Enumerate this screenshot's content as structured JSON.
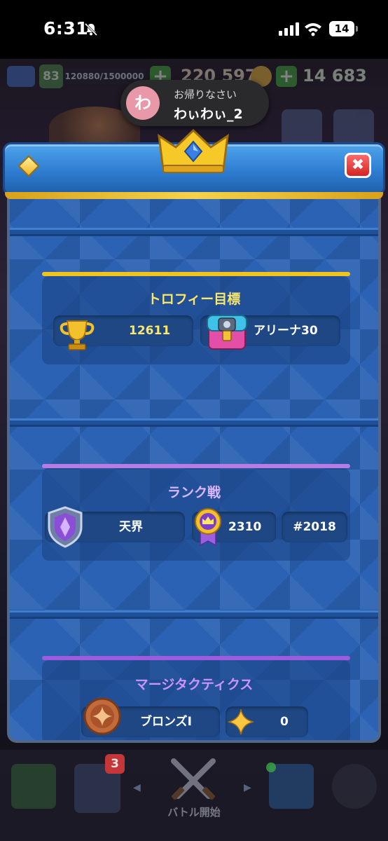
{
  "status_bar": {
    "time": "6:31",
    "battery": "14"
  },
  "hud": {
    "level": "83",
    "xp": "120880/1500000",
    "gold": "220 597",
    "gems": "14 683"
  },
  "toast": {
    "avatar_letter": "わ",
    "title": "お帰りなさい",
    "name": "わぃわぃ_2"
  },
  "modal": {
    "close_label": "✖"
  },
  "trophy_section": {
    "title": "トロフィー目標",
    "trophies": "12611",
    "arena": "アリーナ30"
  },
  "ranked_section": {
    "title": "ランク戦",
    "league": "天界",
    "rating": "2310",
    "rank": "#2018"
  },
  "tactics_section": {
    "title": "マージタクティクス",
    "league": "ブロンズI",
    "points": "0"
  },
  "bottom_nav": {
    "cards_badge": "3",
    "battle_label": "バトル開始"
  },
  "colors": {
    "panel_blue": "#2b62b4",
    "trophy_line": "#f2c41b",
    "ranked_line": "#b77be6",
    "tactics_line": "#9d5ce0",
    "gold_text": "#fbe76a",
    "ranked_text": "#dcb6ff",
    "tactics_text": "#cd94ff"
  }
}
